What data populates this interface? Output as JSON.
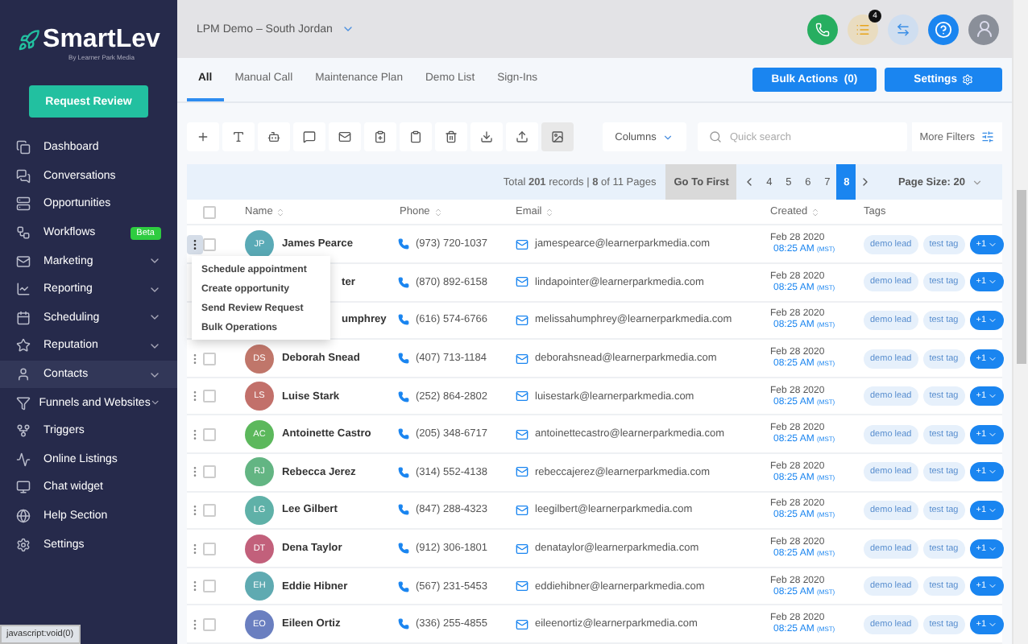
{
  "sidebar": {
    "logo": "SmartLev",
    "logo_subtitle": "By Learner Park Media",
    "cta": "Request Review",
    "items": [
      {
        "kind": "dashboard",
        "label": "Dashboard",
        "selected": false,
        "expandable": false
      },
      {
        "kind": "conversations",
        "label": "Conversations",
        "selected": false,
        "expandable": false
      },
      {
        "kind": "opportunities",
        "label": "Opportunities",
        "selected": false,
        "expandable": false
      },
      {
        "kind": "workflows",
        "label": "Workflows",
        "selected": false,
        "expandable": false,
        "badge": "Beta"
      },
      {
        "kind": "marketing",
        "label": "Marketing",
        "selected": false,
        "expandable": true
      },
      {
        "kind": "reporting",
        "label": "Reporting",
        "selected": false,
        "expandable": true
      },
      {
        "kind": "scheduling",
        "label": "Scheduling",
        "selected": false,
        "expandable": true
      },
      {
        "kind": "reputation",
        "label": "Reputation",
        "selected": false,
        "expandable": true
      },
      {
        "kind": "contacts",
        "label": "Contacts",
        "selected": true,
        "expandable": true
      },
      {
        "kind": "funnels",
        "label": "Funnels and Websites",
        "selected": false,
        "expandable": true
      },
      {
        "kind": "triggers",
        "label": "Triggers",
        "selected": false,
        "expandable": false
      },
      {
        "kind": "listings",
        "label": "Online Listings",
        "selected": false,
        "expandable": false
      },
      {
        "kind": "chat",
        "label": "Chat widget",
        "selected": false,
        "expandable": false
      },
      {
        "kind": "help",
        "label": "Help Section",
        "selected": false,
        "expandable": false
      },
      {
        "kind": "settings",
        "label": "Settings",
        "selected": false,
        "expandable": false
      }
    ]
  },
  "header": {
    "location": "LPM Demo – South Jordan",
    "notification_count": "4"
  },
  "tabs": [
    {
      "label": "All",
      "selected": true
    },
    {
      "label": "Manual Call",
      "selected": false
    },
    {
      "label": "Maintenance Plan",
      "selected": false
    },
    {
      "label": "Demo List",
      "selected": false
    },
    {
      "label": "Sign-Ins",
      "selected": false
    }
  ],
  "bulk_actions": "Bulk Actions  (0)",
  "settings_button": "Settings",
  "tools": [
    {
      "kind": "add",
      "selected": false
    },
    {
      "kind": "filter",
      "selected": false
    },
    {
      "kind": "bot",
      "selected": false
    },
    {
      "kind": "message",
      "selected": false
    },
    {
      "kind": "mail",
      "selected": false
    },
    {
      "kind": "clip-add",
      "selected": false
    },
    {
      "kind": "clip",
      "selected": false
    },
    {
      "kind": "trash",
      "selected": false
    },
    {
      "kind": "download",
      "selected": false
    },
    {
      "kind": "upload",
      "selected": false
    },
    {
      "kind": "image",
      "selected": true
    }
  ],
  "columns_button": "Columns",
  "search": {
    "placeholder": "Quick search"
  },
  "more_filters": "More Filters",
  "pagination": {
    "summary": "Total **201** records | **8** of 11 Pages",
    "first": "Go To First",
    "pages": [
      {
        "label": "4",
        "selected": false
      },
      {
        "label": "5",
        "selected": false
      },
      {
        "label": "6",
        "selected": false
      },
      {
        "label": "7",
        "selected": false
      },
      {
        "label": "8",
        "selected": true
      }
    ],
    "page_size": "Page Size: 20"
  },
  "table": {
    "columns": [
      "Name",
      "Phone",
      "Email",
      "Created",
      "Tags"
    ],
    "select_all": false,
    "rows": [
      {
        "initials": "JP",
        "color": "#5aaab6",
        "name": "James Pearce",
        "phone": "(973) 720-1037",
        "email": "jamespearce@learnerparkmedia.com",
        "date": "Feb 28 2020",
        "time": "08:25 AM",
        "zone": "(MST)",
        "tags": [
          "demo lead",
          "test tag"
        ],
        "more": "+1",
        "menu_open": true,
        "covered": false,
        "checked": false
      },
      {
        "name": "ter",
        "phone": "(870) 892-6158",
        "email": "lindapointer@learnerparkmedia.com",
        "date": "Feb 28 2020",
        "time": "08:25 AM",
        "zone": "(MST)",
        "tags": [
          "demo lead",
          "test tag"
        ],
        "more": "+1",
        "covered": true
      },
      {
        "name": "umphrey",
        "phone": "(616) 574-6766",
        "email": "melissahumphrey@learnerparkmedia.com",
        "date": "Feb 28 2020",
        "time": "08:25 AM",
        "zone": "(MST)",
        "tags": [
          "demo lead",
          "test tag"
        ],
        "more": "+1",
        "covered": true
      },
      {
        "initials": "DS",
        "color": "#c0766a",
        "name": "Deborah Snead",
        "phone": "(407) 713-1184",
        "email": "deborahsnead@learnerparkmedia.com",
        "date": "Feb 28 2020",
        "time": "08:25 AM",
        "zone": "(MST)",
        "tags": [
          "demo lead",
          "test tag"
        ],
        "more": "+1",
        "menu_open": false,
        "covered": false,
        "checked": false
      },
      {
        "initials": "LS",
        "color": "#c2706a",
        "name": "Luise Stark",
        "phone": "(252) 864-2802",
        "email": "luisestark@learnerparkmedia.com",
        "date": "Feb 28 2020",
        "time": "08:25 AM",
        "zone": "(MST)",
        "tags": [
          "demo lead",
          "test tag"
        ],
        "more": "+1",
        "menu_open": false,
        "covered": false,
        "checked": false
      },
      {
        "initials": "AC",
        "color": "#5cb85c",
        "name": "Antoinette Castro",
        "phone": "(205) 348-6717",
        "email": "antoinettecastro@learnerparkmedia.com",
        "date": "Feb 28 2020",
        "time": "08:25 AM",
        "zone": "(MST)",
        "tags": [
          "demo lead",
          "test tag"
        ],
        "more": "+1",
        "menu_open": false,
        "covered": false,
        "checked": false
      },
      {
        "initials": "RJ",
        "color": "#63b583",
        "name": "Rebecca Jerez",
        "phone": "(314) 552-4138",
        "email": "rebeccajerez@learnerparkmedia.com",
        "date": "Feb 28 2020",
        "time": "08:25 AM",
        "zone": "(MST)",
        "tags": [
          "demo lead",
          "test tag"
        ],
        "more": "+1",
        "menu_open": false,
        "covered": false,
        "checked": false
      },
      {
        "initials": "LG",
        "color": "#5fb1a8",
        "name": "Lee Gilbert",
        "phone": "(847) 288-4323",
        "email": "leegilbert@learnerparkmedia.com",
        "date": "Feb 28 2020",
        "time": "08:25 AM",
        "zone": "(MST)",
        "tags": [
          "demo lead",
          "test tag"
        ],
        "more": "+1",
        "menu_open": false,
        "covered": false,
        "checked": false
      },
      {
        "initials": "DT",
        "color": "#c2607b",
        "name": "Dena Taylor",
        "phone": "(912) 306-1801",
        "email": "denataylor@learnerparkmedia.com",
        "date": "Feb 28 2020",
        "time": "08:25 AM",
        "zone": "(MST)",
        "tags": [
          "demo lead",
          "test tag"
        ],
        "more": "+1",
        "menu_open": false,
        "covered": false,
        "checked": false
      },
      {
        "initials": "EH",
        "color": "#5faab1",
        "name": "Eddie Hibner",
        "phone": "(567) 231-5453",
        "email": "eddiehibner@learnerparkmedia.com",
        "date": "Feb 28 2020",
        "time": "08:25 AM",
        "zone": "(MST)",
        "tags": [
          "demo lead",
          "test tag"
        ],
        "more": "+1",
        "menu_open": false,
        "covered": false,
        "checked": false
      },
      {
        "initials": "EO",
        "color": "#6a7fc0",
        "name": "Eileen Ortiz",
        "phone": "(336) 255-4855",
        "email": "eileenortiz@learnerparkmedia.com",
        "date": "Feb 28 2020",
        "time": "08:25 AM",
        "zone": "(MST)",
        "tags": [
          "demo lead",
          "test tag"
        ],
        "more": "+1",
        "menu_open": false,
        "covered": false,
        "checked": false
      }
    ]
  },
  "row_menu": {
    "items": [
      "Schedule appointment",
      "Create opportunity",
      "Send Review Request",
      "Bulk Operations"
    ]
  },
  "status_bar": "javascript:void(0)"
}
